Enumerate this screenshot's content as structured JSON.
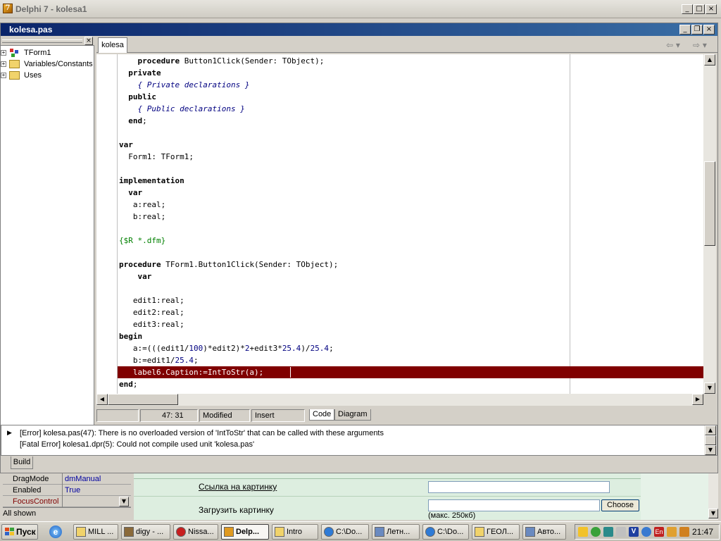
{
  "app": {
    "title": "Delphi 7 - kolesa1"
  },
  "editor": {
    "title": "kolesa.pas",
    "tab": "kolesa",
    "explorer": [
      "TForm1",
      "Variables/Constants",
      "Uses"
    ],
    "lines": [
      [
        [
          "    ",
          ""
        ],
        [
          "procedure",
          "kw"
        ],
        [
          " Button1Click(Sender: TObject);",
          ""
        ]
      ],
      [
        [
          "  ",
          ""
        ],
        [
          "private",
          "kw"
        ]
      ],
      [
        [
          "    ",
          ""
        ],
        [
          "{ Private declarations }",
          "cm"
        ]
      ],
      [
        [
          "  ",
          ""
        ],
        [
          "public",
          "kw"
        ]
      ],
      [
        [
          "    ",
          ""
        ],
        [
          "{ Public declarations }",
          "cm"
        ]
      ],
      [
        [
          "  ",
          ""
        ],
        [
          "end",
          "kw"
        ],
        [
          ";",
          ""
        ]
      ],
      [],
      [
        [
          "var",
          "kw"
        ]
      ],
      [
        [
          "  Form1: TForm1;",
          ""
        ]
      ],
      [],
      [
        [
          "implementation",
          "kw"
        ]
      ],
      [
        [
          "  ",
          ""
        ],
        [
          "var",
          "kw"
        ]
      ],
      [
        [
          "   a:real;",
          ""
        ]
      ],
      [
        [
          "   b:real;",
          ""
        ]
      ],
      [],
      [
        [
          "{$R *.dfm}",
          "dir"
        ]
      ],
      [],
      [
        [
          "procedure",
          "kw"
        ],
        [
          " TForm1.Button1Click(Sender: TObject);",
          ""
        ]
      ],
      [
        [
          "    ",
          ""
        ],
        [
          "var",
          "kw"
        ]
      ],
      [],
      [
        [
          "   edit1:real;",
          ""
        ]
      ],
      [
        [
          "   edit2:real;",
          ""
        ]
      ],
      [
        [
          "   edit3:real;",
          ""
        ]
      ],
      [
        [
          "begin",
          "kw"
        ]
      ],
      [
        [
          "   a:=(((edit1/",
          ""
        ],
        [
          "100",
          "num"
        ],
        [
          ")*edit2)*",
          ""
        ],
        [
          "2",
          "num"
        ],
        [
          "+edit3*",
          ""
        ],
        [
          "25.4",
          "num"
        ],
        [
          ")/",
          ""
        ],
        [
          "25.4",
          "num"
        ],
        [
          ";",
          ""
        ]
      ],
      [
        [
          "   b:=edit1/",
          ""
        ],
        [
          "25.4",
          "num"
        ],
        [
          ";",
          ""
        ]
      ],
      [
        [
          "   label6.Caption:=IntToStr(a);",
          ""
        ]
      ],
      [
        [
          "end",
          "kw"
        ],
        [
          ";",
          ""
        ]
      ]
    ],
    "error_line_index": 26,
    "status": {
      "position": "47:  31",
      "modified": "Modified",
      "mode": "Insert",
      "code_tab": "Code",
      "diagram_tab": "Diagram"
    }
  },
  "messages": {
    "items": [
      "[Error] kolesa.pas(47): There is no overloaded version of 'IntToStr' that can be called with these arguments",
      "[Fatal Error] kolesa1.dpr(5): Could not compile used unit 'kolesa.pas'"
    ],
    "tab": "Build"
  },
  "inspector": {
    "rows": [
      {
        "key": "DragMode",
        "value": "dmManual",
        "key_color": "#000000"
      },
      {
        "key": "Enabled",
        "value": "True",
        "key_color": "#000000"
      },
      {
        "key": "FocusControl",
        "value": "",
        "key_color": "#800000"
      }
    ],
    "footer": "All shown"
  },
  "web": {
    "link_label": "Ссылка на картинку",
    "upload_label": "Загрузить картинку",
    "choose_button": "Choose",
    "max_size_note": "(макс. 250кб)"
  },
  "taskbar": {
    "start": "Пуск",
    "tasks": [
      {
        "label": "MILL ...",
        "icon": "folder-icon"
      },
      {
        "label": "digy - ...",
        "icon": "download-icon"
      },
      {
        "label": "Nissa...",
        "icon": "opera-icon"
      },
      {
        "label": "Delp...",
        "icon": "delphi-icon",
        "active": true
      },
      {
        "label": "Intro",
        "icon": "folder-icon"
      },
      {
        "label": "C:\\Do...",
        "icon": "ie-icon"
      },
      {
        "label": "Летн...",
        "icon": "document-icon"
      },
      {
        "label": "C:\\Do...",
        "icon": "ie-icon"
      },
      {
        "label": "ГЕОЛ...",
        "icon": "folder-icon"
      },
      {
        "label": "Авто...",
        "icon": "document-icon"
      }
    ],
    "language": "En",
    "clock": "21:47"
  }
}
